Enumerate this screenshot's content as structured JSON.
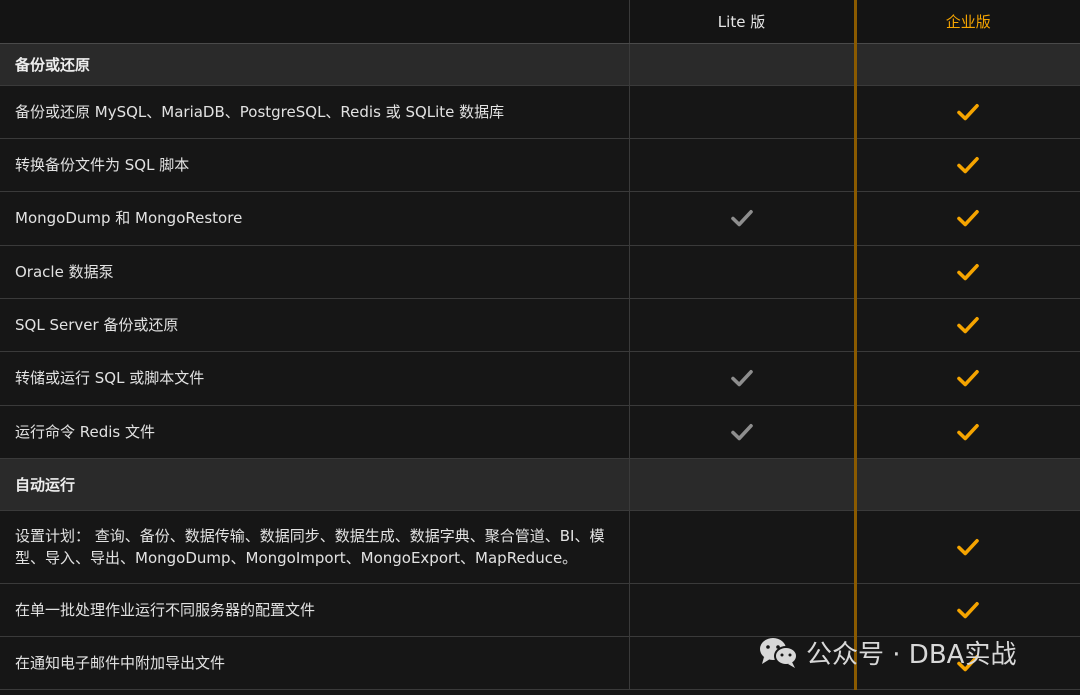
{
  "header": {
    "feature_label": "",
    "lite_label": "Lite 版",
    "enterprise_label": "企业版"
  },
  "colors": {
    "accent": "#f5a400",
    "check_gray": "#8e8e8e",
    "divider": "#8a5a00",
    "section_bg": "#2a2a2a",
    "row_bg": "#161616"
  },
  "sections": [
    {
      "title": "备份或还原",
      "rows": [
        {
          "text": "备份或还原 MySQL、MariaDB、PostgreSQL、Redis 或 SQLite 数据库",
          "lite": false,
          "enterprise": true
        },
        {
          "text": "转换备份文件为 SQL 脚本",
          "lite": false,
          "enterprise": true
        },
        {
          "text": "MongoDump 和 MongoRestore",
          "lite": true,
          "enterprise": true
        },
        {
          "text": "Oracle 数据泵",
          "lite": false,
          "enterprise": true
        },
        {
          "text": "SQL Server 备份或还原",
          "lite": false,
          "enterprise": true
        },
        {
          "text": "转储或运行 SQL 或脚本文件",
          "lite": true,
          "enterprise": true
        },
        {
          "text": "运行命令 Redis 文件",
          "lite": true,
          "enterprise": true
        }
      ]
    },
    {
      "title": "自动运行",
      "rows": [
        {
          "text": "设置计划： 查询、备份、数据传输、数据同步、数据生成、数据字典、聚合管道、BI、模型、导入、导出、MongoDump、MongoImport、MongoExport、MapReduce。",
          "lite": false,
          "enterprise": true
        },
        {
          "text": "在单一批处理作业运行不同服务器的配置文件",
          "lite": false,
          "enterprise": true
        },
        {
          "text": "在通知电子邮件中附加导出文件",
          "lite": false,
          "enterprise": true
        }
      ]
    }
  ],
  "watermark": {
    "icon": "wechat-icon",
    "text": "公众号 · DBA实战"
  }
}
